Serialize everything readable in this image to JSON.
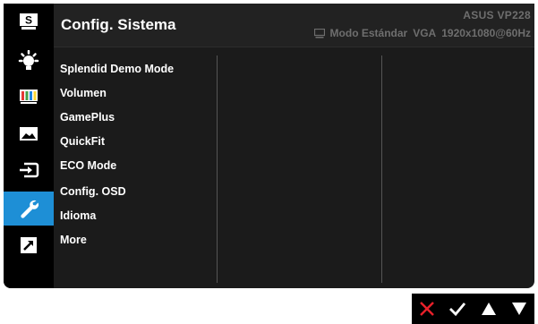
{
  "header": {
    "title": "Config. Sistema",
    "model": "ASUS  VP228",
    "mode": "Modo Estándar",
    "input": "VGA",
    "resolution": "1920x1080@60Hz"
  },
  "sidebar": {
    "items": [
      {
        "icon": "splendid-s-icon",
        "active": false
      },
      {
        "icon": "brightness-sun-icon",
        "active": false
      },
      {
        "icon": "color-bars-icon",
        "active": false
      },
      {
        "icon": "image-landscape-icon",
        "active": false
      },
      {
        "icon": "input-select-icon",
        "active": false
      },
      {
        "icon": "wrench-icon",
        "active": true
      },
      {
        "icon": "shortcut-arrow-icon",
        "active": false
      }
    ]
  },
  "menu": {
    "items": [
      {
        "label": "Splendid Demo Mode"
      },
      {
        "label": "Volumen"
      },
      {
        "label": "GamePlus"
      },
      {
        "label": "QuickFit"
      },
      {
        "label": "ECO Mode"
      },
      {
        "label": "Config. OSD"
      },
      {
        "label": "Idioma"
      },
      {
        "label": "More"
      }
    ]
  },
  "footer": {
    "buttons": [
      "close-x-icon",
      "confirm-check-icon",
      "up-triangle-icon",
      "down-triangle-icon"
    ]
  },
  "colors": {
    "accent": "#1e8fd6",
    "close": "#e8202a",
    "panel": "#1b1b1b"
  }
}
